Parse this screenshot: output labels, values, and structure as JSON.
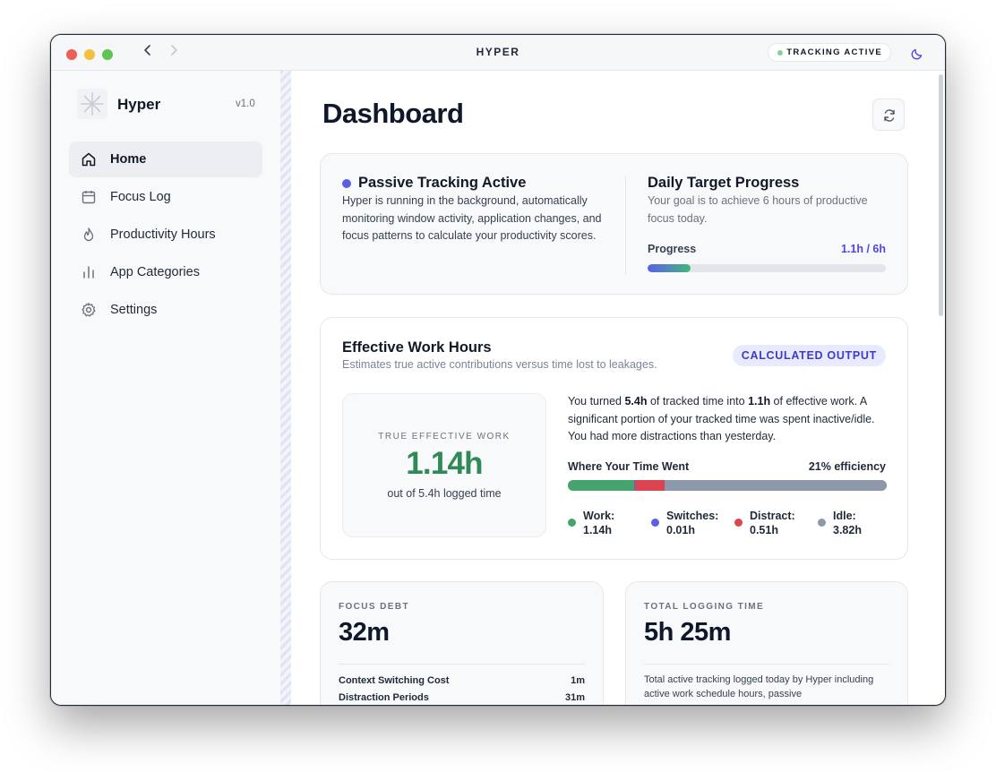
{
  "window": {
    "title": "HYPER",
    "tracking_status": "TRACKING ACTIVE"
  },
  "sidebar": {
    "brand": "Hyper",
    "version": "v1.0",
    "items": [
      {
        "label": "Home",
        "icon": "home-icon",
        "active": true
      },
      {
        "label": "Focus Log",
        "icon": "calendar-icon",
        "active": false
      },
      {
        "label": "Productivity Hours",
        "icon": "flame-icon",
        "active": false
      },
      {
        "label": "App Categories",
        "icon": "bar-chart-icon",
        "active": false
      },
      {
        "label": "Settings",
        "icon": "gear-icon",
        "active": false
      }
    ]
  },
  "main": {
    "title": "Dashboard",
    "tracking_card": {
      "title": "Passive Tracking Active",
      "description": "Hyper is running in the background, automatically monitoring window activity, application changes, and focus patterns to calculate your productivity scores.",
      "target_title": "Daily Target Progress",
      "target_description": "Your goal is to achieve 6 hours of productive focus today.",
      "progress_label": "Progress",
      "progress_value": "1.1h / 6h",
      "progress_fraction": 0.18
    },
    "effective_work": {
      "title": "Effective Work Hours",
      "subtitle": "Estimates true active contributions versus time lost to leakages.",
      "badge": "CALCULATED OUTPUT",
      "metric_label": "TRUE EFFECTIVE WORK",
      "metric_value": "1.14h",
      "metric_sub": "out of 5.4h logged time",
      "summary_prefix": "You turned ",
      "summary_tracked": "5.4h",
      "summary_mid": " of tracked time into ",
      "summary_effective": "1.1h",
      "summary_suffix": " of effective work. A significant portion of your tracked time was spent inactive/idle. You had more distractions than yesterday.",
      "breakdown_label": "Where Your Time Went",
      "efficiency": "21% efficiency",
      "breakdown": [
        {
          "label": "Work:",
          "value": "1.14h",
          "hours": 1.14,
          "color": "#45a36e"
        },
        {
          "label": "Switches:",
          "value": "0.01h",
          "hours": 0.01,
          "color": "#5b5fe8"
        },
        {
          "label": "Distract:",
          "value": "0.51h",
          "hours": 0.51,
          "color": "#db4552"
        },
        {
          "label": "Idle:",
          "value": "3.82h",
          "hours": 3.82,
          "color": "#8e98ab"
        }
      ]
    },
    "focus_debt": {
      "label": "FOCUS DEBT",
      "value": "32m",
      "rows": [
        {
          "label": "Context Switching Cost",
          "value": "1m"
        },
        {
          "label": "Distraction Periods",
          "value": "31m"
        }
      ]
    },
    "total_logging": {
      "label": "TOTAL LOGGING TIME",
      "value": "5h 25m",
      "description": "Total active tracking logged today by Hyper including active work schedule hours, passive"
    }
  }
}
